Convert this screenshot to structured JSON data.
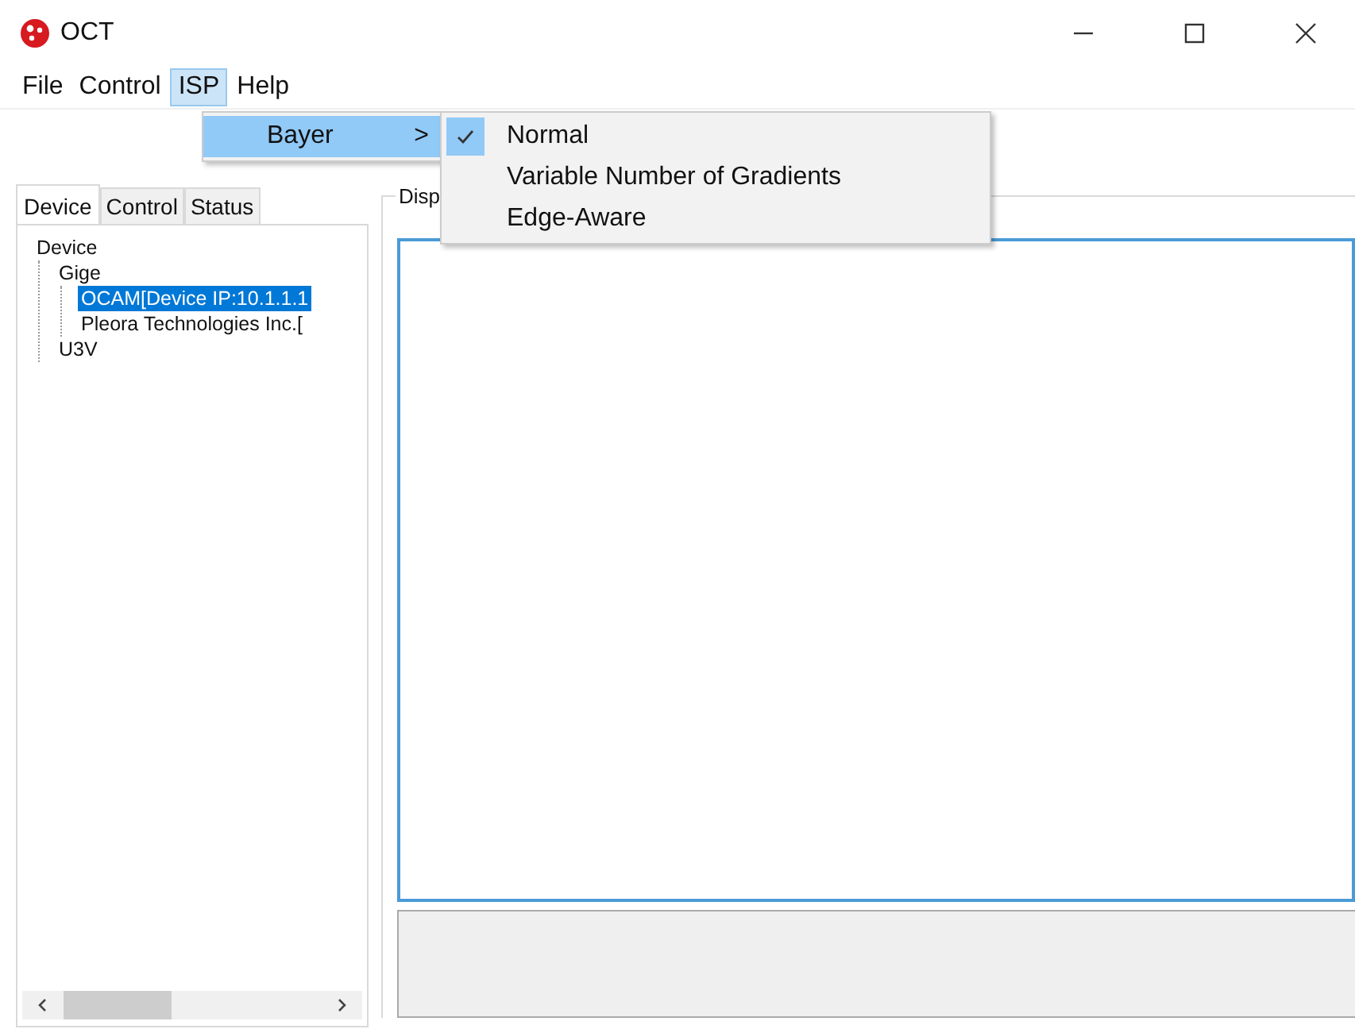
{
  "window": {
    "title": "OCT"
  },
  "menu": [
    {
      "label": "File",
      "selected": false
    },
    {
      "label": "Control",
      "selected": false
    },
    {
      "label": "ISP",
      "selected": true
    },
    {
      "label": "Help",
      "selected": false
    }
  ],
  "isp_menu": {
    "items": [
      {
        "label": "Bayer",
        "arrow": ">",
        "selected": true
      }
    ]
  },
  "bayer_menu": {
    "items": [
      {
        "label": "Normal",
        "checked": true
      },
      {
        "label": "Variable Number of Gradients",
        "checked": false
      },
      {
        "label": "Edge-Aware",
        "checked": false
      }
    ]
  },
  "left_tabs": [
    {
      "label": "Device",
      "selected": true
    },
    {
      "label": "Control",
      "selected": false
    },
    {
      "label": "Status",
      "selected": false
    }
  ],
  "tree": [
    {
      "label": "Device",
      "selected": false,
      "children": [
        {
          "label": "Gige",
          "selected": false,
          "children": [
            {
              "label": "OCAM[Device IP:10.1.1.1",
              "selected": true
            },
            {
              "label": "Pleora Technologies Inc.[",
              "selected": false
            }
          ]
        },
        {
          "label": "U3V",
          "selected": false
        }
      ]
    }
  ],
  "display_group": {
    "title": "Disp"
  }
}
